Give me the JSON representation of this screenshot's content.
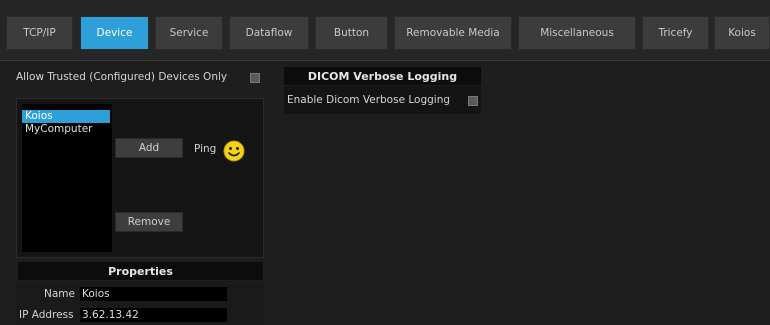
{
  "tabs": [
    {
      "label": "TCP/IP",
      "active": false
    },
    {
      "label": "Device",
      "active": true
    },
    {
      "label": "Service",
      "active": false
    },
    {
      "label": "Dataflow",
      "active": false
    },
    {
      "label": "Button",
      "active": false
    },
    {
      "label": "Removable Media",
      "active": false
    },
    {
      "label": "Miscellaneous",
      "active": false
    },
    {
      "label": "Tricefy",
      "active": false
    },
    {
      "label": "Koios",
      "active": false
    }
  ],
  "device": {
    "allow_trusted_label": "Allow Trusted (Configured) Devices Only",
    "devices": [
      "Koios",
      "MyComputer"
    ],
    "selected_device": "Koios",
    "add_label": "Add",
    "remove_label": "Remove",
    "ping_label": "Ping",
    "ping_status_icon": "smiley-icon"
  },
  "properties": {
    "header": "Properties",
    "name_label": "Name",
    "name_value": "Koios",
    "ip_label": "IP Address",
    "ip_value": "3.62.13.42"
  },
  "dicom": {
    "header": "DICOM Verbose Logging",
    "enable_label": "Enable Dicom Verbose Logging"
  },
  "colors": {
    "accent": "#2e9fd9",
    "ping_ok": "#f2d21b"
  }
}
